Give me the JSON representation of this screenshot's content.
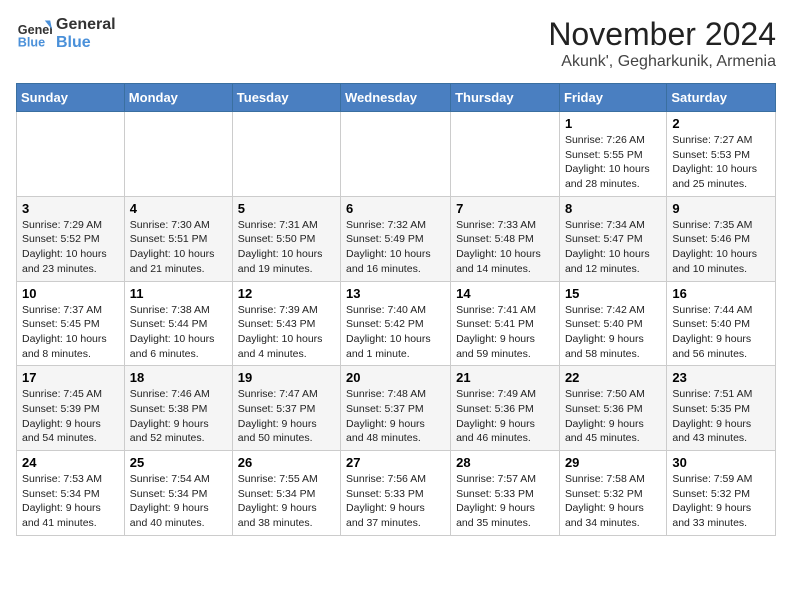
{
  "logo": {
    "text_general": "General",
    "text_blue": "Blue"
  },
  "title": "November 2024",
  "location": "Akunk', Gegharkunik, Armenia",
  "days_of_week": [
    "Sunday",
    "Monday",
    "Tuesday",
    "Wednesday",
    "Thursday",
    "Friday",
    "Saturday"
  ],
  "weeks": [
    [
      {
        "day": "",
        "info": ""
      },
      {
        "day": "",
        "info": ""
      },
      {
        "day": "",
        "info": ""
      },
      {
        "day": "",
        "info": ""
      },
      {
        "day": "",
        "info": ""
      },
      {
        "day": "1",
        "info": "Sunrise: 7:26 AM\nSunset: 5:55 PM\nDaylight: 10 hours and 28 minutes."
      },
      {
        "day": "2",
        "info": "Sunrise: 7:27 AM\nSunset: 5:53 PM\nDaylight: 10 hours and 25 minutes."
      }
    ],
    [
      {
        "day": "3",
        "info": "Sunrise: 7:29 AM\nSunset: 5:52 PM\nDaylight: 10 hours and 23 minutes."
      },
      {
        "day": "4",
        "info": "Sunrise: 7:30 AM\nSunset: 5:51 PM\nDaylight: 10 hours and 21 minutes."
      },
      {
        "day": "5",
        "info": "Sunrise: 7:31 AM\nSunset: 5:50 PM\nDaylight: 10 hours and 19 minutes."
      },
      {
        "day": "6",
        "info": "Sunrise: 7:32 AM\nSunset: 5:49 PM\nDaylight: 10 hours and 16 minutes."
      },
      {
        "day": "7",
        "info": "Sunrise: 7:33 AM\nSunset: 5:48 PM\nDaylight: 10 hours and 14 minutes."
      },
      {
        "day": "8",
        "info": "Sunrise: 7:34 AM\nSunset: 5:47 PM\nDaylight: 10 hours and 12 minutes."
      },
      {
        "day": "9",
        "info": "Sunrise: 7:35 AM\nSunset: 5:46 PM\nDaylight: 10 hours and 10 minutes."
      }
    ],
    [
      {
        "day": "10",
        "info": "Sunrise: 7:37 AM\nSunset: 5:45 PM\nDaylight: 10 hours and 8 minutes."
      },
      {
        "day": "11",
        "info": "Sunrise: 7:38 AM\nSunset: 5:44 PM\nDaylight: 10 hours and 6 minutes."
      },
      {
        "day": "12",
        "info": "Sunrise: 7:39 AM\nSunset: 5:43 PM\nDaylight: 10 hours and 4 minutes."
      },
      {
        "day": "13",
        "info": "Sunrise: 7:40 AM\nSunset: 5:42 PM\nDaylight: 10 hours and 1 minute."
      },
      {
        "day": "14",
        "info": "Sunrise: 7:41 AM\nSunset: 5:41 PM\nDaylight: 9 hours and 59 minutes."
      },
      {
        "day": "15",
        "info": "Sunrise: 7:42 AM\nSunset: 5:40 PM\nDaylight: 9 hours and 58 minutes."
      },
      {
        "day": "16",
        "info": "Sunrise: 7:44 AM\nSunset: 5:40 PM\nDaylight: 9 hours and 56 minutes."
      }
    ],
    [
      {
        "day": "17",
        "info": "Sunrise: 7:45 AM\nSunset: 5:39 PM\nDaylight: 9 hours and 54 minutes."
      },
      {
        "day": "18",
        "info": "Sunrise: 7:46 AM\nSunset: 5:38 PM\nDaylight: 9 hours and 52 minutes."
      },
      {
        "day": "19",
        "info": "Sunrise: 7:47 AM\nSunset: 5:37 PM\nDaylight: 9 hours and 50 minutes."
      },
      {
        "day": "20",
        "info": "Sunrise: 7:48 AM\nSunset: 5:37 PM\nDaylight: 9 hours and 48 minutes."
      },
      {
        "day": "21",
        "info": "Sunrise: 7:49 AM\nSunset: 5:36 PM\nDaylight: 9 hours and 46 minutes."
      },
      {
        "day": "22",
        "info": "Sunrise: 7:50 AM\nSunset: 5:36 PM\nDaylight: 9 hours and 45 minutes."
      },
      {
        "day": "23",
        "info": "Sunrise: 7:51 AM\nSunset: 5:35 PM\nDaylight: 9 hours and 43 minutes."
      }
    ],
    [
      {
        "day": "24",
        "info": "Sunrise: 7:53 AM\nSunset: 5:34 PM\nDaylight: 9 hours and 41 minutes."
      },
      {
        "day": "25",
        "info": "Sunrise: 7:54 AM\nSunset: 5:34 PM\nDaylight: 9 hours and 40 minutes."
      },
      {
        "day": "26",
        "info": "Sunrise: 7:55 AM\nSunset: 5:34 PM\nDaylight: 9 hours and 38 minutes."
      },
      {
        "day": "27",
        "info": "Sunrise: 7:56 AM\nSunset: 5:33 PM\nDaylight: 9 hours and 37 minutes."
      },
      {
        "day": "28",
        "info": "Sunrise: 7:57 AM\nSunset: 5:33 PM\nDaylight: 9 hours and 35 minutes."
      },
      {
        "day": "29",
        "info": "Sunrise: 7:58 AM\nSunset: 5:32 PM\nDaylight: 9 hours and 34 minutes."
      },
      {
        "day": "30",
        "info": "Sunrise: 7:59 AM\nSunset: 5:32 PM\nDaylight: 9 hours and 33 minutes."
      }
    ]
  ]
}
